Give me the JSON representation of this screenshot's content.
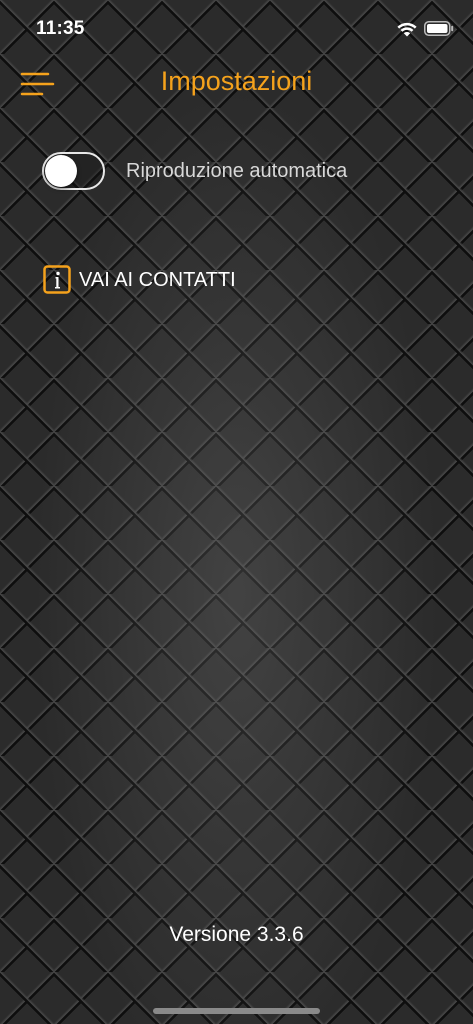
{
  "status_bar": {
    "time": "11:35"
  },
  "header": {
    "title": "Impostazioni",
    "menu_icon": "hamburger-menu-icon",
    "accent_color": "#f5a21c"
  },
  "settings": {
    "autoplay_label": "Riproduzione automatica",
    "autoplay_on": false
  },
  "contacts": {
    "label": "VAI AI CONTATTI",
    "icon": "info-icon"
  },
  "footer": {
    "version": "Versione 3.3.6"
  }
}
